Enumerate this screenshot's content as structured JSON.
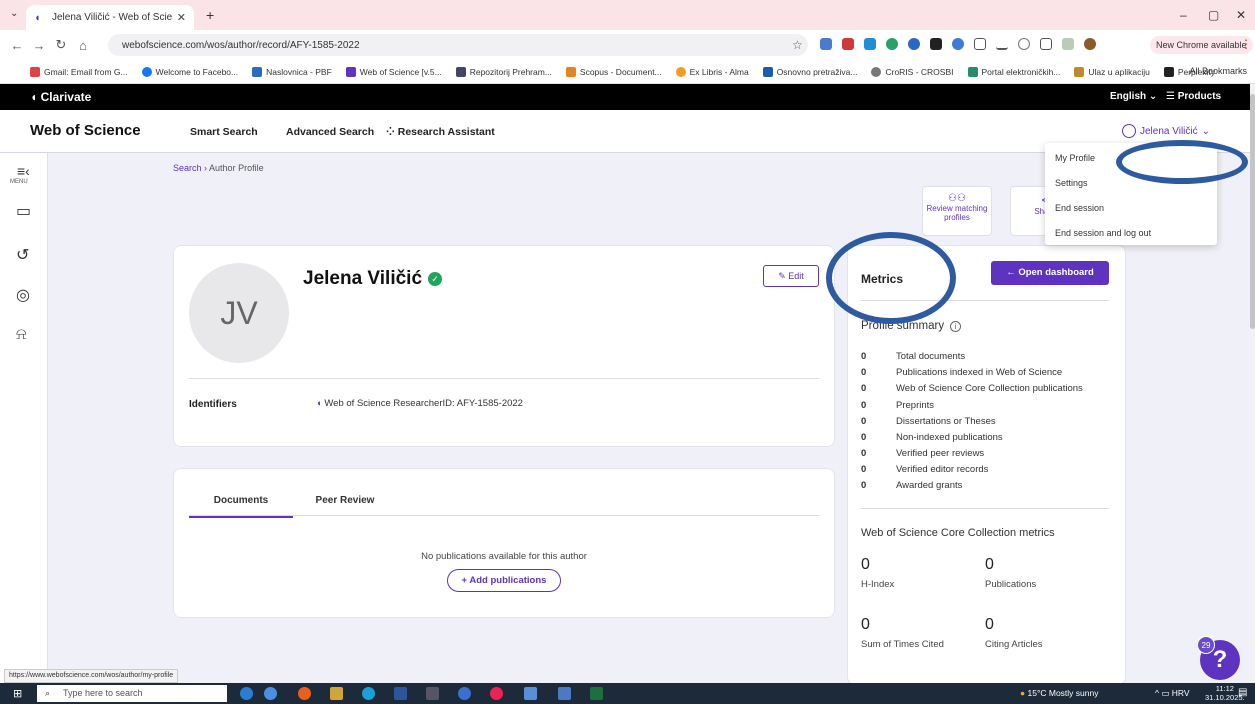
{
  "browser": {
    "tab_title": "Jelena Viličić - Web of Science |",
    "url": "webofscience.com/wos/author/record/AFY-1585-2022",
    "new_chrome": "New Chrome available",
    "bookmarks": [
      "Gmail: Email from G...",
      "Welcome to Facebo...",
      "Naslovnica - PBF",
      "Web of Science [v.5...",
      "Repozitorij Prehram...",
      "Scopus - Document...",
      "Ex Libris - Alma",
      "Osnovno pretraživa...",
      "CroRIS - CROSBI",
      "Portal elektroničkih...",
      "Ulaz u aplikaciju",
      "Perplexity"
    ],
    "all_bookmarks": "All Bookmarks",
    "status_url": "https://www.webofscience.com/wos/author/my-profile"
  },
  "clarivate": {
    "logo": "Clarivate",
    "language": "English",
    "products": "Products"
  },
  "nav": {
    "brand": "Web of Science",
    "smart_search": "Smart Search",
    "advanced_search": "Advanced Search",
    "research_assistant": "Research Assistant",
    "user": "Jelena Viličić"
  },
  "rail": {
    "menu": "MENU"
  },
  "breadcrumb": {
    "search": "Search",
    "current": "Author Profile"
  },
  "actions": {
    "review": "Review matching profiles",
    "share": "Share"
  },
  "profile": {
    "initials": "JV",
    "name": "Jelena Viličić",
    "edit": "Edit",
    "identifiers_label": "Identifiers",
    "researcher_id": "Web of Science ResearcherID: AFY-1585-2022"
  },
  "documents": {
    "tab_documents": "Documents",
    "tab_peer_review": "Peer Review",
    "empty": "No publications available for this author",
    "add": "Add publications"
  },
  "metrics": {
    "title": "Metrics",
    "open_dashboard": "Open dashboard",
    "profile_summary": "Profile summary",
    "rows": [
      {
        "n": "0",
        "label": "Total documents"
      },
      {
        "n": "0",
        "label": "Publications indexed in Web of Science"
      },
      {
        "n": "0",
        "label": "Web of Science Core Collection publications"
      },
      {
        "n": "0",
        "label": "Preprints"
      },
      {
        "n": "0",
        "label": "Dissertations or Theses"
      },
      {
        "n": "0",
        "label": "Non-indexed publications"
      },
      {
        "n": "0",
        "label": "Verified peer reviews"
      },
      {
        "n": "0",
        "label": "Verified editor records"
      },
      {
        "n": "0",
        "label": "Awarded grants"
      }
    ],
    "core_title": "Web of Science Core Collection metrics",
    "h_index": {
      "n": "0",
      "label": "H-Index"
    },
    "publications": {
      "n": "0",
      "label": "Publications"
    },
    "times_cited": {
      "n": "0",
      "label": "Sum of Times Cited"
    },
    "citing": {
      "n": "0",
      "label": "Citing Articles"
    }
  },
  "dropdown": {
    "my_profile": "My Profile",
    "settings": "Settings",
    "end_session": "End session",
    "end_logout": "End session and log out"
  },
  "help": {
    "badge": "29",
    "icon": "?"
  },
  "taskbar": {
    "search": "Type here to search",
    "weather": "15°C  Mostly sunny",
    "lang": "HRV",
    "time": "11:12",
    "date": "31.10.2025."
  },
  "colors": {
    "accent": "#5e33bf",
    "annotation": "#2e5aa0",
    "verified": "#22a45a"
  }
}
